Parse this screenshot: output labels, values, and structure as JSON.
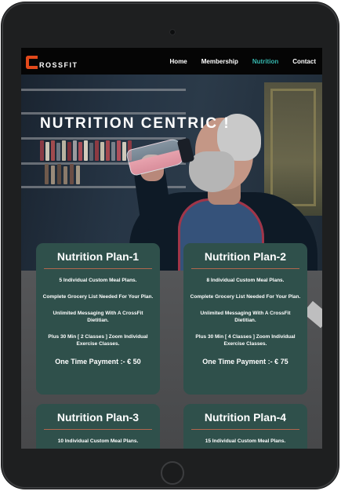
{
  "nav": {
    "logo_text": "ROSSFIT",
    "links": [
      "Home",
      "Membership",
      "Nutrition",
      "Contact"
    ],
    "active": "Nutrition",
    "accent_color": "#35b7ae",
    "logo_color": "#e2491b"
  },
  "hero": {
    "title": "NUTRITION CENTRIC !"
  },
  "plans": [
    {
      "title": "Nutrition Plan-1",
      "lines": [
        "5 Individual Custom Meal Plans.",
        "Complete Grocery List Needed For Your Plan.",
        "Unlimited Messaging With A CrossFit Dietitian.",
        "Plus 30 Min [ 2 Classes ] Zoom Individual Exercise Classes."
      ],
      "price": "One Time Payment :- € 50"
    },
    {
      "title": "Nutrition Plan-2",
      "lines": [
        "8 Individual Custom Meal Plans.",
        "Complete Grocery List Needed For Your Plan.",
        "Unlimited Messaging With A CrossFit Dietitian.",
        "Plus 30 Min [ 4 Classes ] Zoom Individual Exercise Classes."
      ],
      "price": "One Time Payment :- € 75"
    },
    {
      "title": "Nutrition Plan-3",
      "lines": [
        "10 Individual Custom Meal Plans."
      ]
    },
    {
      "title": "Nutrition Plan-4",
      "lines": [
        "15 Individual Custom Meal Plans."
      ]
    }
  ],
  "colors": {
    "card_bg": "#2f504b",
    "divider": "#b0664e"
  }
}
